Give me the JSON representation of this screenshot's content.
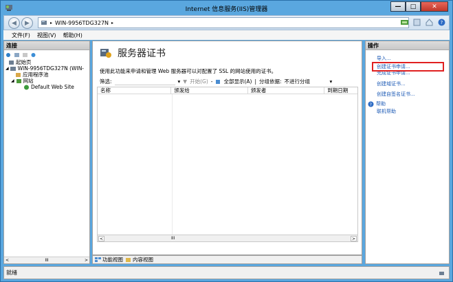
{
  "window": {
    "title": "Internet 信息服务(IIS)管理器"
  },
  "nav": {
    "server": "WIN-9956TDG327N",
    "separator": "▸"
  },
  "menu": [
    "文件(F)",
    "视图(V)",
    "帮助(H)"
  ],
  "left": {
    "header": "连接",
    "tree": [
      {
        "label": "起始页",
        "level": 0
      },
      {
        "label": "WIN-9956TDG327N (WIN-",
        "level": 0
      },
      {
        "label": "应用程序池",
        "level": 1
      },
      {
        "label": "网站",
        "level": 1
      },
      {
        "label": "Default Web Site",
        "level": 2
      }
    ],
    "scroll_thumb": "III"
  },
  "center": {
    "title": "服务器证书",
    "description": "使用此功能来申请和管理 Web 服务器可以对配置了 SSL 的网站使用的证书。",
    "filter_label": "筛选:",
    "start_label": "开始(G)",
    "show_all_label": "全部显示(A)",
    "group_label": "分组依据:",
    "group_value": "不进行分组",
    "columns": [
      "名称",
      "颁发给",
      "颁发者",
      "到期日期"
    ],
    "scroll_thumb": "III"
  },
  "tabs": {
    "features": "功能视图",
    "content": "内容视图"
  },
  "actions": {
    "header": "操作",
    "items": [
      "导入...",
      "创建证书申请...",
      "完成证书申请...",
      "创建域证书...",
      "创建自签名证书..."
    ],
    "help": "帮助",
    "online_help": "联机帮助"
  },
  "status": {
    "text": "就绪"
  },
  "colors": {
    "link": "#1b59b5",
    "highlight": "#e02020",
    "chrome": "#5aa7df"
  }
}
